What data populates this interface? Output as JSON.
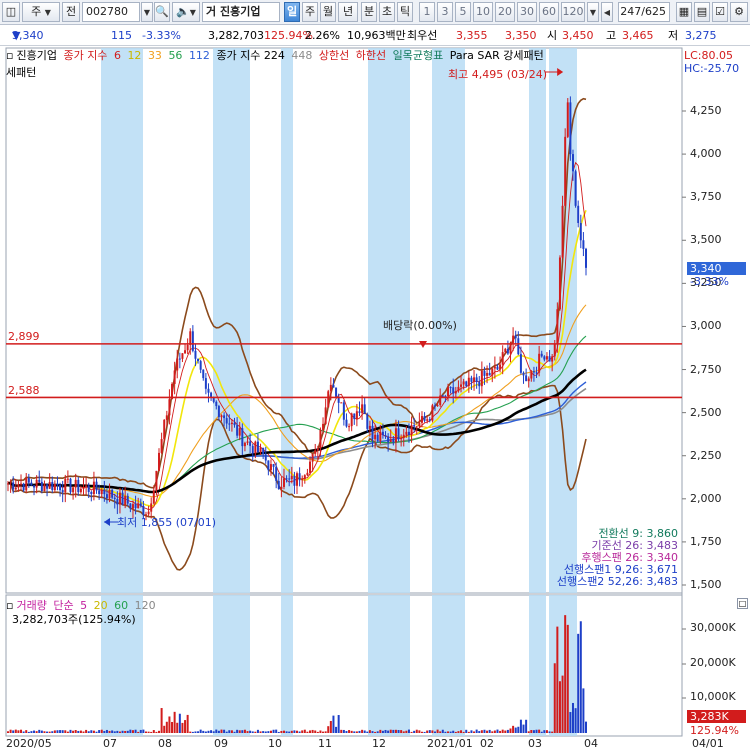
{
  "toolbar": {
    "btn_type": "주",
    "btn_all": "전",
    "code": "002780",
    "name_prefix": "거",
    "name": "진흥기업",
    "periods": [
      "일",
      "주",
      "월",
      "년",
      "분",
      "초",
      "틱"
    ],
    "active_period": "일",
    "intervals": [
      "1",
      "3",
      "5",
      "10",
      "20",
      "30",
      "60",
      "120"
    ],
    "page_count": "247/625"
  },
  "info": {
    "price": "3,340",
    "change": "115",
    "change_pct": "-3.33%",
    "volume": "3,282,703",
    "vol_ratio": "125.94%",
    "turnover": "2.26%",
    "amount": "10,963백만",
    "broker": "최우선",
    "ask": "3,355",
    "bid": "3,350",
    "open_label": "시",
    "open": "3,450",
    "high_label": "고",
    "high": "3,465",
    "low_label": "저",
    "low": "3,275"
  },
  "colors": {
    "up": "#d21c1c",
    "down": "#1d3fc8",
    "highlight_band": "#b7dcf5",
    "ma5": "#d21c1c",
    "ma12": "#f2e60b",
    "ma33": "#f0a020",
    "ma56": "#25a050",
    "ma112": "#2e5fd6",
    "ma224": "#000000",
    "ma448": "#8c8c8c",
    "bollinger": "#8b4a1c",
    "hline": "#d21c1c",
    "vol_ma5": "#c3219f",
    "vol_ma20": "#f0a020",
    "vol_ma60": "#25a050"
  },
  "legend": {
    "stock": "진흥기업",
    "ma_label": "종가 지수",
    "ma_periods": [
      "6",
      "12",
      "33",
      "56",
      "112"
    ],
    "ma2_label": "종가 지수 224",
    "ma2_extra": "448",
    "upper_limit": "상한선",
    "lower_limit": "하한선",
    "ichimoku": "일목균형표",
    "psar": "Para SAR 강세패턴",
    "psar_line2": "세패턴"
  },
  "lc_hc": {
    "lc": "LC:80.05",
    "hc": "HC:-25.70"
  },
  "price_axis": [
    "4,250",
    "4,000",
    "3,750",
    "3,500",
    "3,250",
    "3,000",
    "2,750",
    "2,500",
    "2,250",
    "2,000",
    "1,750",
    "1,500"
  ],
  "current_price_tag": "3,340",
  "current_change_tag": "-3.33%",
  "hlines": [
    {
      "label": "2,899",
      "value": 2899
    },
    {
      "label": "2,588",
      "value": 2588
    }
  ],
  "annotations": {
    "high": "최고 4,495 (03/24)",
    "low": "최저 1,855 (07/01)",
    "dividend": "배당락(0.00%)"
  },
  "ichimoku_values": [
    "전환선 9: 3,860",
    "기준선 26: 3,483",
    "후행스팬 26: 3,340",
    "선행스팬1 9,26: 3,671",
    "선행스팬2 52,26: 3,483"
  ],
  "volume": {
    "legend_label": "거래량",
    "ma_label": "단순",
    "ma_periods": [
      "5",
      "20",
      "60",
      "120"
    ],
    "current": "3,282,703주(125.94%)",
    "axis": [
      "30,000K",
      "20,000K",
      "10,000K"
    ],
    "current_tag": "3,283K",
    "current_pct": "125.94%"
  },
  "date_axis": [
    "2020/05",
    "07",
    "08",
    "09",
    "10",
    "11",
    "12",
    "2021/01",
    "02",
    "03",
    "04",
    "04/01"
  ]
}
